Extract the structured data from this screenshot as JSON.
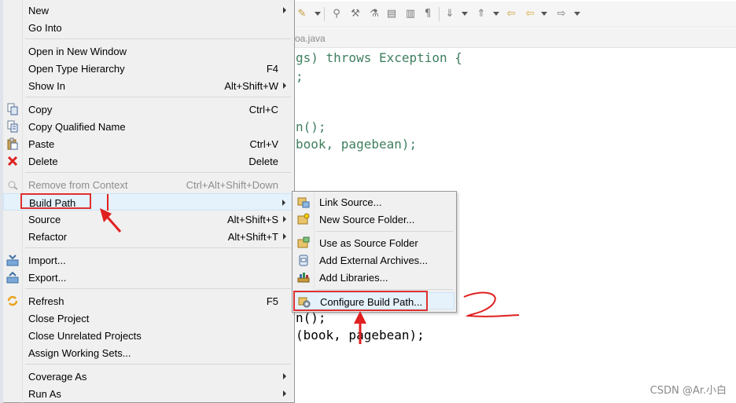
{
  "editor": {
    "tab_label": "oa.java",
    "lines": [
      {
        "text": "gs) throws Exception {"
      },
      {
        "text": ";"
      },
      {
        "text": "n();"
      },
      {
        "text": "book, pagebean);"
      },
      {
        "text": "n();"
      },
      {
        "text": "(book, pagebean);"
      }
    ]
  },
  "menu": {
    "items": [
      {
        "label": "New",
        "shortcut": "",
        "submenu": true
      },
      {
        "label": "Go Into",
        "shortcut": ""
      },
      {
        "label": "Open in New Window",
        "shortcut": ""
      },
      {
        "label": "Open Type Hierarchy",
        "shortcut": "F4"
      },
      {
        "label": "Show In",
        "shortcut": "Alt+Shift+W",
        "submenu": true
      },
      {
        "label": "Copy",
        "shortcut": "Ctrl+C"
      },
      {
        "label": "Copy Qualified Name",
        "shortcut": ""
      },
      {
        "label": "Paste",
        "shortcut": "Ctrl+V"
      },
      {
        "label": "Delete",
        "shortcut": "Delete"
      },
      {
        "label": "Remove from Context",
        "shortcut": "Ctrl+Alt+Shift+Down",
        "disabled": true
      },
      {
        "label": "Build Path",
        "shortcut": "",
        "submenu": true
      },
      {
        "label": "Source",
        "shortcut": "Alt+Shift+S",
        "submenu": true
      },
      {
        "label": "Refactor",
        "shortcut": "Alt+Shift+T",
        "submenu": true
      },
      {
        "label": "Import...",
        "shortcut": ""
      },
      {
        "label": "Export...",
        "shortcut": ""
      },
      {
        "label": "Refresh",
        "shortcut": "F5"
      },
      {
        "label": "Close Project",
        "shortcut": ""
      },
      {
        "label": "Close Unrelated Projects",
        "shortcut": ""
      },
      {
        "label": "Assign Working Sets...",
        "shortcut": ""
      },
      {
        "label": "Coverage As",
        "shortcut": "",
        "submenu": true
      },
      {
        "label": "Run As",
        "shortcut": "",
        "submenu": true
      }
    ]
  },
  "submenu": {
    "items": [
      {
        "label": "Link Source..."
      },
      {
        "label": "New Source Folder..."
      },
      {
        "label": "Use as Source Folder"
      },
      {
        "label": "Add External Archives..."
      },
      {
        "label": "Add Libraries..."
      },
      {
        "label": "Configure Build Path..."
      }
    ]
  },
  "annotation": {
    "number": "2"
  },
  "watermark": "CSDN @Ar.小白",
  "colors": {
    "highlight_red": "#e03030",
    "hover_blue": "#e5f1fb",
    "code_green": "#3f7f5f"
  }
}
